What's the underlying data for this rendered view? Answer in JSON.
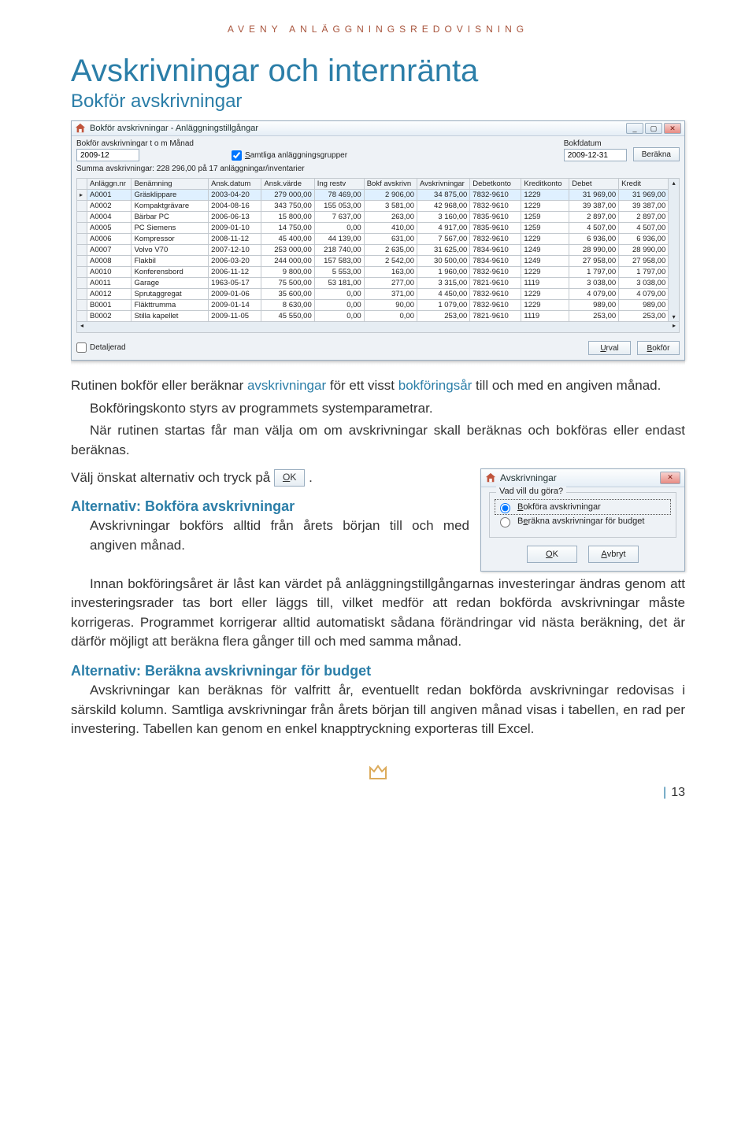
{
  "header": {
    "kicker": "AVENY ANLÄGGNINGSREDOVISNING",
    "title": "Avskrivningar och internränta",
    "subtitle": "Bokför avskrivningar"
  },
  "window": {
    "icon": "home-icon",
    "title": "Bokför avskrivningar - Anläggningstillgångar",
    "win_min": "_",
    "win_max": "▢",
    "win_close": "✕",
    "manad_label": "Bokför avskrivningar t o m Månad",
    "manad_value": "2009-12",
    "samtliga_label": "Samtliga anläggningsgrupper",
    "samtliga_accel": "S",
    "bokfdatum_label": "Bokfdatum",
    "bokfdatum_value": "2009-12-31",
    "berakna_btn": "Beräkna",
    "summary": "Summa avskrivningar: 228 296,00 på 17 anläggningar/inventarier",
    "columns": [
      "Anläggn.nr",
      "Benämning",
      "Ansk.datum",
      "Ansk.värde",
      "Ing restv",
      "Bokf avskrivn",
      "Avskrivningar",
      "Debetkonto",
      "Kreditkonto",
      "Debet",
      "Kredit"
    ],
    "rows": [
      {
        "sel": true,
        "c": [
          "A0001",
          "Gräsklippare",
          "2003-04-20",
          "279 000,00",
          "78 469,00",
          "2 906,00",
          "34 875,00",
          "7832-9610",
          "1229",
          "31 969,00",
          "31 969,00"
        ]
      },
      {
        "sel": false,
        "c": [
          "A0002",
          "Kompaktgrävare",
          "2004-08-16",
          "343 750,00",
          "155 053,00",
          "3 581,00",
          "42 968,00",
          "7832-9610",
          "1229",
          "39 387,00",
          "39 387,00"
        ]
      },
      {
        "sel": false,
        "c": [
          "A0004",
          "Bärbar PC",
          "2006-06-13",
          "15 800,00",
          "7 637,00",
          "263,00",
          "3 160,00",
          "7835-9610",
          "1259",
          "2 897,00",
          "2 897,00"
        ]
      },
      {
        "sel": false,
        "c": [
          "A0005",
          "PC Siemens",
          "2009-01-10",
          "14 750,00",
          "0,00",
          "410,00",
          "4 917,00",
          "7835-9610",
          "1259",
          "4 507,00",
          "4 507,00"
        ]
      },
      {
        "sel": false,
        "c": [
          "A0006",
          "Kompressor",
          "2008-11-12",
          "45 400,00",
          "44 139,00",
          "631,00",
          "7 567,00",
          "7832-9610",
          "1229",
          "6 936,00",
          "6 936,00"
        ]
      },
      {
        "sel": false,
        "c": [
          "A0007",
          "Volvo V70",
          "2007-12-10",
          "253 000,00",
          "218 740,00",
          "2 635,00",
          "31 625,00",
          "7834-9610",
          "1249",
          "28 990,00",
          "28 990,00"
        ]
      },
      {
        "sel": false,
        "c": [
          "A0008",
          "Flakbil",
          "2006-03-20",
          "244 000,00",
          "157 583,00",
          "2 542,00",
          "30 500,00",
          "7834-9610",
          "1249",
          "27 958,00",
          "27 958,00"
        ]
      },
      {
        "sel": false,
        "c": [
          "A0010",
          "Konferensbord",
          "2006-11-12",
          "9 800,00",
          "5 553,00",
          "163,00",
          "1 960,00",
          "7832-9610",
          "1229",
          "1 797,00",
          "1 797,00"
        ]
      },
      {
        "sel": false,
        "c": [
          "A0011",
          "Garage",
          "1963-05-17",
          "75 500,00",
          "53 181,00",
          "277,00",
          "3 315,00",
          "7821-9610",
          "1119",
          "3 038,00",
          "3 038,00"
        ]
      },
      {
        "sel": false,
        "c": [
          "A0012",
          "Sprutaggregat",
          "2009-01-06",
          "35 600,00",
          "0,00",
          "371,00",
          "4 450,00",
          "7832-9610",
          "1229",
          "4 079,00",
          "4 079,00"
        ]
      },
      {
        "sel": false,
        "c": [
          "B0001",
          "Fläkttrumma",
          "2009-01-14",
          "8 630,00",
          "0,00",
          "90,00",
          "1 079,00",
          "7832-9610",
          "1229",
          "989,00",
          "989,00"
        ]
      },
      {
        "sel": false,
        "c": [
          "B0002",
          "Stilla kapellet",
          "2009-11-05",
          "45 550,00",
          "0,00",
          "0,00",
          "253,00",
          "7821-9610",
          "1119",
          "253,00",
          "253,00"
        ]
      }
    ],
    "detaljerad_label": "Detaljerad",
    "urval_btn": "Urval",
    "bokfor_btn": "Bokför"
  },
  "dialog": {
    "icon": "home-icon",
    "title": "Avskrivningar",
    "close": "✕",
    "legend": "Vad vill du göra?",
    "opt1": "Bokföra avskrivningar",
    "opt2": "Beräkna avskrivningar för budget",
    "ok": "OK",
    "avbryt": "Avbryt"
  },
  "prose": {
    "p1a": "Rutinen bokför eller beräknar ",
    "p1b": "avskrivningar",
    "p1c": " för ett visst ",
    "p1d": "bokföringsår",
    "p1e": " till och med en angiven månad.",
    "p2": "Bokföringskonto styrs av programmets systemparametrar.",
    "p3": "När rutinen startas får man välja om om avskrivningar skall beräknas och bokföras eller endast beräknas.",
    "p4a": "Välj önskat alternativ och tryck på ",
    "p4b_ok": "OK",
    "p4c": " .",
    "h1": "Alternativ: Bokföra avskrivningar",
    "p5": "Avskrivningar bokförs alltid från årets början till och med angiven månad.",
    "p6": "Innan bokföringsåret är låst kan värdet på anläggningstillgångarnas investeringar ändras genom att investeringsrader tas bort eller läggs till, vilket medför att redan bokförda avskrivningar måste korrigeras. Programmet korrigerar alltid automatiskt sådana förändringar vid nästa beräkning, det är därför möjligt att beräkna flera gånger till och med samma månad.",
    "h2": "Alternativ: Beräkna avskrivningar för budget",
    "p7": "Avskrivningar kan beräknas för valfritt år, eventuellt redan bokförda avskrivningar redovisas i särskild kolumn. Samtliga avskrivningar från årets början till angiven månad visas i tabellen, en rad per investering. Tabellen kan genom en enkel knapptryckning exporteras till Excel."
  },
  "pagenum": "13",
  "colors": {
    "accent": "#2b7ea8",
    "brand": "#a8543c"
  }
}
